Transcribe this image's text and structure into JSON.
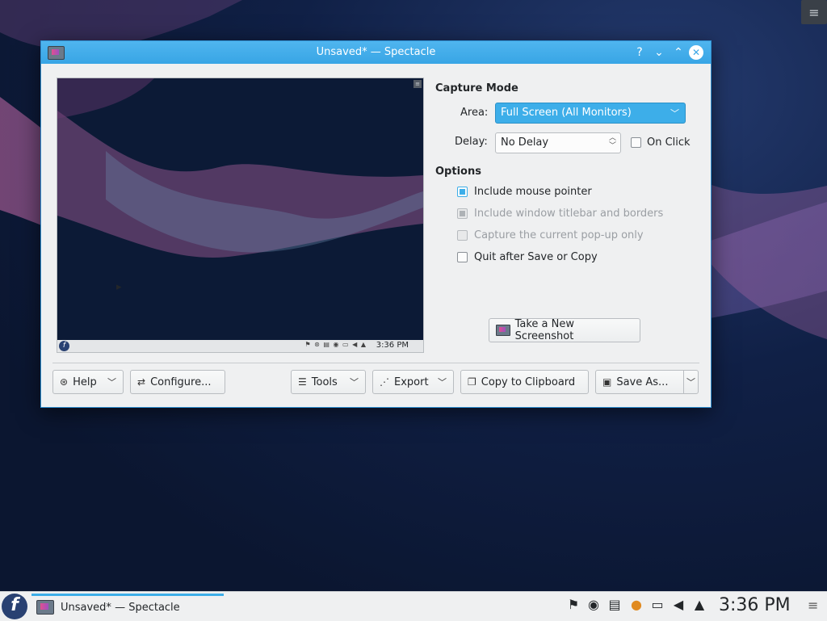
{
  "window": {
    "title": "Unsaved* — Spectacle",
    "help_glyph": "?",
    "minimize_glyph": "⌄",
    "maximize_glyph": "⌃",
    "close_glyph": "✕"
  },
  "preview": {
    "clock": "3:36 PM",
    "tray_glyphs": "⚑ ⊛ ▤ ◉ ▭ ◀ ▲",
    "menu_glyph": "≡",
    "fedora_glyph": "f"
  },
  "capture_mode": {
    "heading": "Capture Mode",
    "area_label": "Area:",
    "area_value": "Full Screen (All Monitors)",
    "delay_label": "Delay:",
    "delay_value": "No Delay",
    "on_click_label": "On Click",
    "on_click_checked": false
  },
  "options": {
    "heading": "Options",
    "items": [
      {
        "label": "Include mouse pointer",
        "checked": true,
        "enabled": true
      },
      {
        "label": "Include window titlebar and borders",
        "checked": true,
        "enabled": false
      },
      {
        "label": "Capture the current pop-up only",
        "checked": false,
        "enabled": false
      },
      {
        "label": "Quit after Save or Copy",
        "checked": false,
        "enabled": true
      }
    ]
  },
  "buttons": {
    "take_screenshot": "Take a New Screenshot",
    "help": "Help",
    "configure": "Configure...",
    "tools": "Tools",
    "export": "Export",
    "copy": "Copy to Clipboard",
    "save_as": "Save As..."
  },
  "icons": {
    "help": "life-ring-icon",
    "configure": "sliders-icon",
    "tools": "hamburger-icon",
    "export": "share-icon",
    "copy": "copy-icon",
    "save": "save-icon"
  },
  "taskbar": {
    "task_label": "Unsaved* — Spectacle",
    "clock": "3:36 PM",
    "fedora_glyph": "f",
    "menu_glyph": "≡"
  },
  "colors": {
    "accent": "#3daee9",
    "titlebar": "#3ea9e8",
    "window_bg": "#eff0f1"
  }
}
